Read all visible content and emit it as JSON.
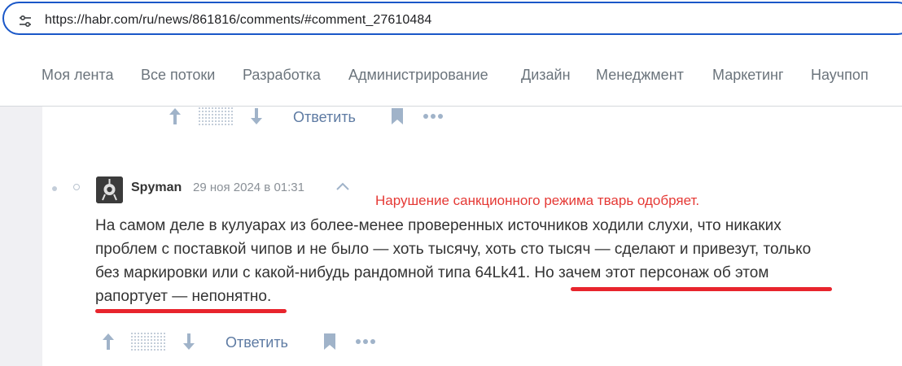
{
  "browser": {
    "url": "https://habr.com/ru/news/861816/comments/#comment_27610484"
  },
  "nav": {
    "items": [
      "Моя лента",
      "Все потоки",
      "Разработка",
      "Администрирование",
      "Дизайн",
      "Менеджмент",
      "Маркетинг",
      "Научпоп"
    ]
  },
  "prev_comment": {
    "reply_label": "Ответить"
  },
  "comment": {
    "author": "Spyman",
    "date": "29 ноя 2024 в 01:31",
    "annotation": "Нарушение санкционного режима тварь одобряет.",
    "lines": [
      "На самом деле в кулуарах из более-менее проверенных источников ходили слухи, что никаких",
      "проблем с поставкой чипов и не было — хоть тысячу, хоть сто тысяч — сделают и привезут, только",
      "без маркировки или с какой-нибудь рандомной типа 64Lk41. Но зачем этот персонаж об этом",
      "рапортует — непонятно."
    ],
    "reply_label": "Ответить"
  },
  "colors": {
    "accent": "#1a57c8",
    "underline": "#e8252d",
    "annotation": "#e53935",
    "link": "#5e7ba3",
    "icon": "#a0b3c9"
  }
}
